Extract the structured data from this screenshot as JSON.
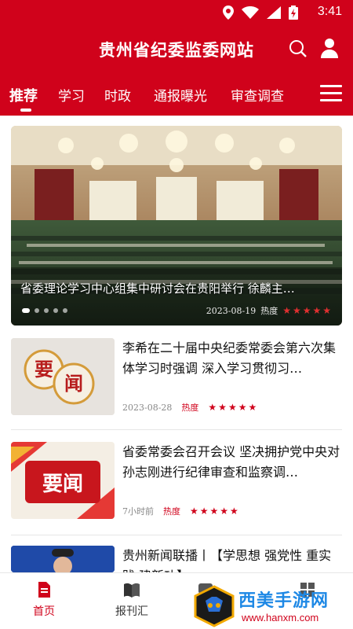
{
  "status_bar": {
    "time": "3:41"
  },
  "header": {
    "title": "贵州省纪委监委网站"
  },
  "tabs": [
    {
      "label": "推荐",
      "active": true
    },
    {
      "label": "学习"
    },
    {
      "label": "时政"
    },
    {
      "label": "通报曝光"
    },
    {
      "label": "审查调查"
    }
  ],
  "hero": {
    "caption": "省委理论学习中心组集中研讨会在贵阳举行 徐麟主…",
    "date": "2023-08-19",
    "hot_label": "热度",
    "stars": "★★★★★"
  },
  "news": [
    {
      "title": "李希在二十届中央纪委常委会第六次集体学习时强调 深入学习贯彻习…",
      "date": "2023-08-28",
      "hot_label": "热度",
      "stars": "★★★★★",
      "thumb_text": [
        "要",
        "闻"
      ]
    },
    {
      "title": "省委常委会召开会议 坚决拥护党中央对孙志刚进行纪律审查和监察调…",
      "date": "7小时前",
      "hot_label": "热度",
      "stars": "★★★★★",
      "thumb_text": "要闻"
    },
    {
      "title": "贵州新闻联播丨【学思想 强党性 重实践 建新功】",
      "date": "",
      "hot_label": "",
      "stars": ""
    }
  ],
  "bottom_nav": [
    {
      "label": "首页",
      "active": true,
      "icon": "home-doc-icon"
    },
    {
      "label": "报刊汇",
      "icon": "book-icon"
    },
    {
      "label": "",
      "icon": "chat-icon"
    },
    {
      "label": "",
      "icon": "grid-icon"
    }
  ],
  "watermark": {
    "text": "西美手游网",
    "url": "www.hanxm.com"
  },
  "colors": {
    "brand_red": "#d0021b",
    "watermark_blue": "#1e88e5"
  }
}
